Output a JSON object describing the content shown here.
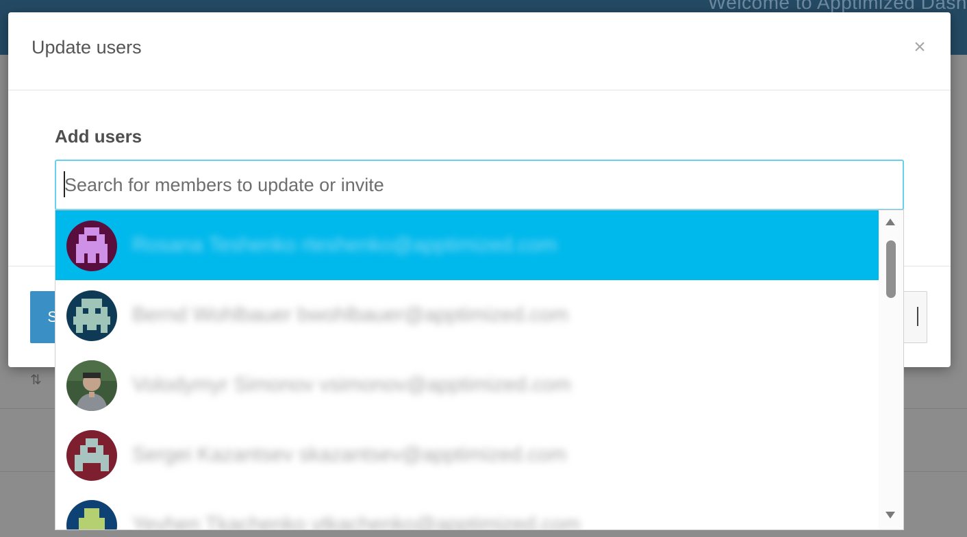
{
  "background": {
    "welcome_text": "Welcome to Apptimized Dash",
    "sort_icon": "sort-icon"
  },
  "modal": {
    "title": "Update users",
    "close_glyph": "×",
    "field_label": "Add users",
    "primary_button_label": "S"
  },
  "search": {
    "placeholder": "Search for members to update or invite",
    "value": ""
  },
  "dropdown": {
    "items": [
      {
        "label": "Rosana Teshenko rteshenko@apptimized.com",
        "avatar_color": "#5a0e3e",
        "avatar_fg": "#cf90e8",
        "active": true
      },
      {
        "label": "Bernd Wohlbauer bwohlbauer@apptimized.com",
        "avatar_color": "#0e3a55",
        "avatar_fg": "#9fc4b8",
        "active": false
      },
      {
        "label": "Volodymyr Simonov vsimonov@apptimized.com",
        "avatar_color": "#3c5a3a",
        "avatar_fg": "#c4a38c",
        "active": false
      },
      {
        "label": "Sergei Kazantsev skazantsev@apptimized.com",
        "avatar_color": "#7d1f2e",
        "avatar_fg": "#a8c4c0",
        "active": false
      },
      {
        "label": "Yevhen Tkachenko ytkachenko@apptimized.com",
        "avatar_color": "#0e4275",
        "avatar_fg": "#b4d070",
        "active": false
      }
    ]
  },
  "colors": {
    "accent": "#00b9ec",
    "primary_button": "#3a8fc4",
    "input_focus_border": "#66d0ee"
  }
}
